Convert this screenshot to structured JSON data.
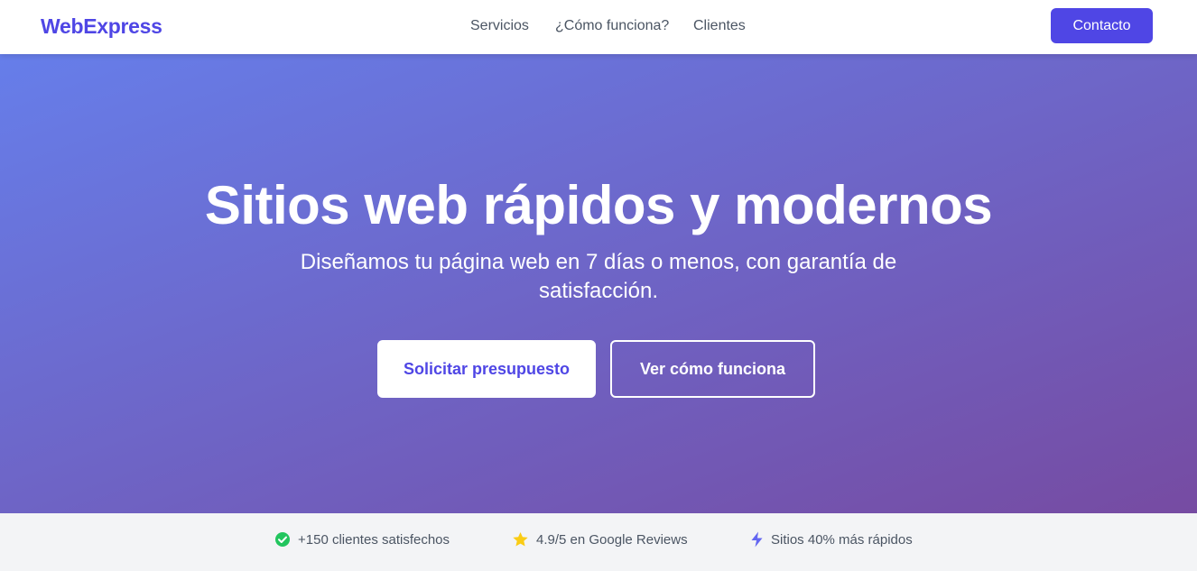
{
  "brand": {
    "name": "WebExpress",
    "color": "#4f46e5"
  },
  "nav": {
    "links": [
      "Servicios",
      "¿Cómo funciona?",
      "Clientes"
    ],
    "contact_label": "Contacto"
  },
  "hero": {
    "title": "Sitios web rápidos y modernos",
    "subtitle": "Diseñamos tu página web en 7 días o menos, con garantía de satisfacción.",
    "primary_cta": "Solicitar presupuesto",
    "secondary_cta": "Ver cómo funciona",
    "gradient_start": "#667eea",
    "gradient_end": "#764ba2"
  },
  "trust": [
    {
      "icon": "check-circle-icon",
      "color": "#22c55e",
      "text": "+150 clientes satisfechos"
    },
    {
      "icon": "star-icon",
      "color": "#facc15",
      "text": "4.9/5 en Google Reviews"
    },
    {
      "icon": "bolt-icon",
      "color": "#6366f1",
      "text": "Sitios 40% más rápidos"
    }
  ]
}
